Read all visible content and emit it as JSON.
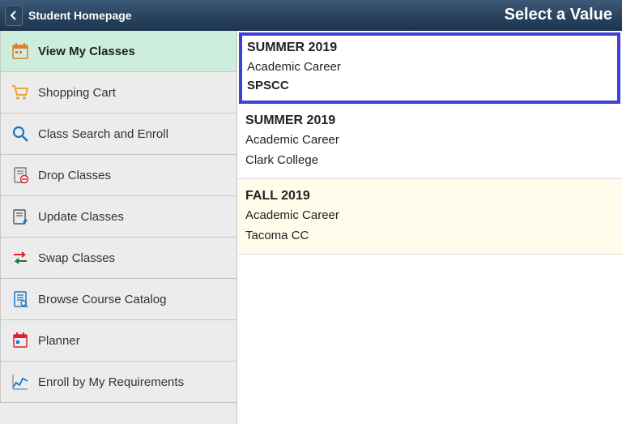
{
  "header": {
    "back_label": "Student Homepage",
    "title": "Select a Value"
  },
  "sidebar": {
    "items": [
      {
        "label": "View My Classes",
        "icon": "calendar"
      },
      {
        "label": "Shopping Cart",
        "icon": "cart"
      },
      {
        "label": "Class Search and Enroll",
        "icon": "search"
      },
      {
        "label": "Drop Classes",
        "icon": "drop"
      },
      {
        "label": "Update Classes",
        "icon": "update"
      },
      {
        "label": "Swap Classes",
        "icon": "swap"
      },
      {
        "label": "Browse Course Catalog",
        "icon": "catalog"
      },
      {
        "label": "Planner",
        "icon": "planner"
      },
      {
        "label": "Enroll by My Requirements",
        "icon": "requirements"
      }
    ]
  },
  "main": {
    "terms": [
      {
        "title": "SUMMER 2019",
        "career": "Academic Career",
        "school": "SPSCC",
        "highlighted": true
      },
      {
        "title": "SUMMER 2019",
        "career": "Academic Career",
        "school": "Clark College",
        "highlighted": false
      },
      {
        "title": "FALL 2019",
        "career": "Academic Career",
        "school": "Tacoma CC",
        "highlighted": false,
        "hovered": true
      }
    ]
  }
}
